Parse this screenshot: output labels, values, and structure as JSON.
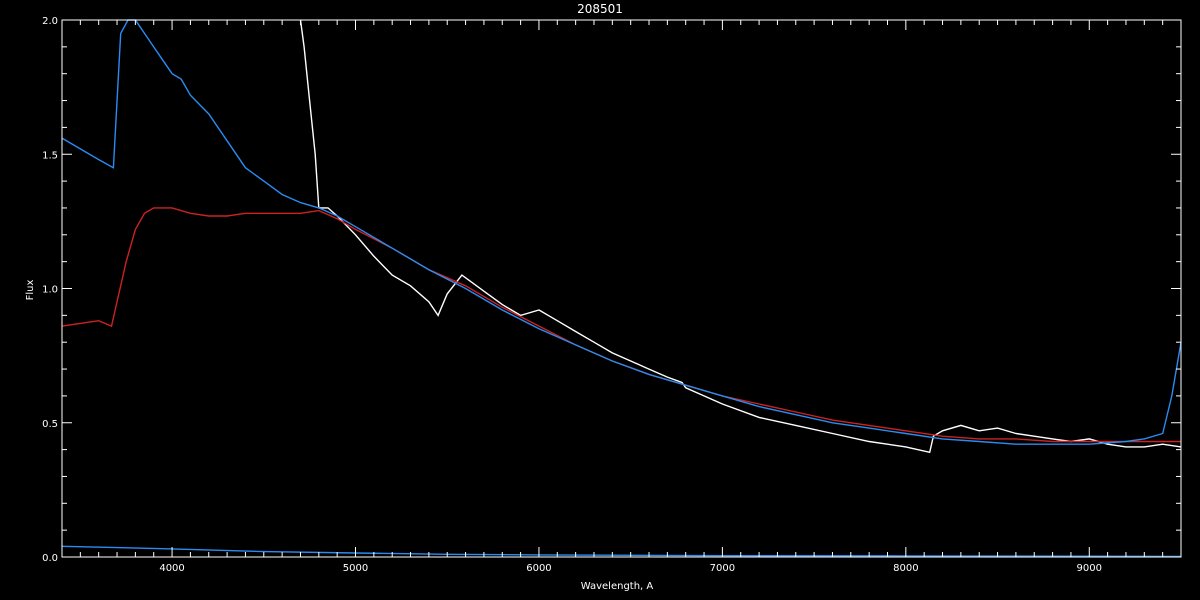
{
  "chart_data": {
    "type": "line",
    "title": "208501",
    "xlabel": "Wavelength, A",
    "ylabel": "Flux",
    "xlim": [
      3400,
      9500
    ],
    "ylim": [
      0.0,
      2.0
    ],
    "x_ticks": [
      4000,
      5000,
      6000,
      7000,
      8000,
      9000
    ],
    "x_tick_labels": [
      "4000",
      "5000",
      "6000",
      "7000",
      "8000",
      "9000"
    ],
    "y_ticks": [
      0.0,
      0.5,
      1.0,
      1.5,
      2.0
    ],
    "y_tick_labels": [
      "0.0",
      "0.5",
      "1.0",
      "1.5",
      "2.0"
    ],
    "grid": false,
    "background": "#000000",
    "series": [
      {
        "color": "#ffffff",
        "x": [
          4700,
          4720,
          4750,
          4780,
          4800,
          4850,
          4900,
          5000,
          5100,
          5200,
          5300,
          5400,
          5450,
          5500,
          5580,
          5700,
          5800,
          5900,
          6000,
          6100,
          6200,
          6300,
          6400,
          6500,
          6600,
          6700,
          6780,
          6800,
          6900,
          7000,
          7200,
          7400,
          7600,
          7800,
          8000,
          8130,
          8150,
          8200,
          8300,
          8400,
          8500,
          8600,
          8700,
          8800,
          8900,
          9000,
          9100,
          9200,
          9300,
          9400,
          9500
        ],
        "y": [
          2.0,
          1.9,
          1.7,
          1.5,
          1.3,
          1.3,
          1.27,
          1.2,
          1.12,
          1.05,
          1.01,
          0.95,
          0.9,
          0.98,
          1.05,
          0.99,
          0.94,
          0.9,
          0.92,
          0.88,
          0.84,
          0.8,
          0.76,
          0.73,
          0.7,
          0.67,
          0.65,
          0.63,
          0.6,
          0.57,
          0.52,
          0.49,
          0.46,
          0.43,
          0.41,
          0.39,
          0.45,
          0.47,
          0.49,
          0.47,
          0.48,
          0.46,
          0.45,
          0.44,
          0.43,
          0.44,
          0.42,
          0.41,
          0.41,
          0.42,
          0.41
        ]
      },
      {
        "color": "#cc2222",
        "x": [
          3400,
          3500,
          3600,
          3670,
          3700,
          3750,
          3800,
          3850,
          3900,
          4000,
          4100,
          4200,
          4300,
          4400,
          4500,
          4600,
          4700,
          4800,
          4900,
          5000,
          5200,
          5400,
          5600,
          5800,
          6000,
          6200,
          6400,
          6600,
          6800,
          7000,
          7200,
          7400,
          7600,
          7800,
          8000,
          8200,
          8400,
          8600,
          8800,
          9000,
          9200,
          9400,
          9500
        ],
        "y": [
          0.86,
          0.87,
          0.88,
          0.86,
          0.95,
          1.1,
          1.22,
          1.28,
          1.3,
          1.3,
          1.28,
          1.27,
          1.27,
          1.28,
          1.28,
          1.28,
          1.28,
          1.29,
          1.26,
          1.22,
          1.15,
          1.07,
          1.01,
          0.93,
          0.86,
          0.79,
          0.73,
          0.68,
          0.64,
          0.6,
          0.57,
          0.54,
          0.51,
          0.49,
          0.47,
          0.45,
          0.44,
          0.44,
          0.43,
          0.43,
          0.43,
          0.43,
          0.43
        ]
      },
      {
        "color": "#2a8cf0",
        "x": [
          3400,
          3500,
          3600,
          3680,
          3720,
          3760,
          3800,
          3850,
          3900,
          3950,
          4000,
          4050,
          4100,
          4200,
          4300,
          4400,
          4500,
          4600,
          4700,
          4800,
          4900,
          5000,
          5200,
          5400,
          5600,
          5800,
          6000,
          6200,
          6400,
          6600,
          6800,
          7000,
          7200,
          7400,
          7600,
          7800,
          8000,
          8200,
          8400,
          8600,
          8800,
          9000,
          9200,
          9300,
          9400,
          9450,
          9500
        ],
        "y": [
          1.56,
          1.52,
          1.48,
          1.45,
          1.95,
          2.0,
          2.0,
          1.95,
          1.9,
          1.85,
          1.8,
          1.78,
          1.72,
          1.65,
          1.55,
          1.45,
          1.4,
          1.35,
          1.32,
          1.3,
          1.27,
          1.23,
          1.15,
          1.07,
          1.0,
          0.92,
          0.85,
          0.79,
          0.73,
          0.68,
          0.64,
          0.6,
          0.56,
          0.53,
          0.5,
          0.48,
          0.46,
          0.44,
          0.43,
          0.42,
          0.42,
          0.42,
          0.43,
          0.44,
          0.46,
          0.6,
          0.8
        ]
      },
      {
        "color": "#2a8cf0",
        "x": [
          3400,
          4000,
          4500,
          5000,
          5500,
          6000,
          7000,
          8000,
          9000,
          9500
        ],
        "y": [
          0.04,
          0.03,
          0.02,
          0.015,
          0.01,
          0.008,
          0.005,
          0.004,
          0.003,
          0.002
        ]
      }
    ]
  }
}
